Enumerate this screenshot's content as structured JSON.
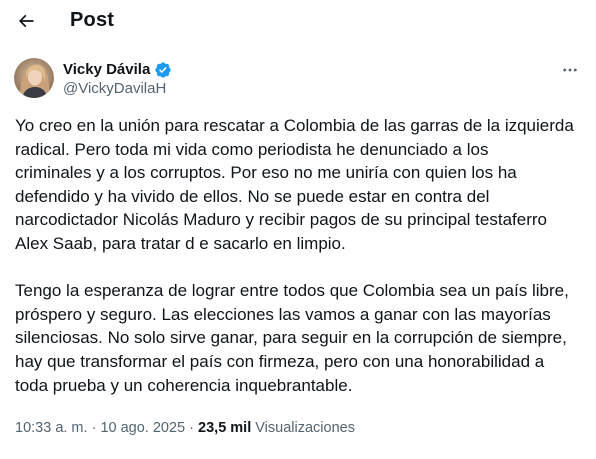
{
  "header": {
    "back_icon": "arrow-left-icon",
    "title": "Post"
  },
  "author": {
    "display_name": "Vicky Dávila",
    "handle": "@VickyDavilaH",
    "verified_icon": "verified-badge-icon",
    "verified_color": "#1d9bf0"
  },
  "more_icon": "more-horizontal-icon",
  "tweet": {
    "paragraphs": [
      "Yo creo en la unión para rescatar a Colombia de las garras de la izquierda\nradical. Pero toda mi vida como periodista he denunciado a los\ncriminales y a los corruptos. Por eso no me uniría con quien los ha\ndefendido y ha vivido de ellos. No se puede estar en contra del\nnarcodictador Nicolás Maduro y recibir pagos de su principal testaferro\nAlex Saab, para tratar d e sacarlo en limpio.",
      "Tengo la esperanza de lograr entre todos que Colombia sea un país libre,\npróspero y seguro. Las elecciones las vamos a ganar con las mayorías\nsilenciosas. No solo sirve ganar, para seguir en la corrupción de siempre,\nhay que transformar el país con firmeza, pero con una honorabilidad a\ntoda prueba y un coherencia inquebrantable."
    ]
  },
  "meta": {
    "time": "10:33 a. m.",
    "separator": "·",
    "date": "10 ago. 2025",
    "views_count": "23,5 mil",
    "views_label": "Visualizaciones"
  }
}
